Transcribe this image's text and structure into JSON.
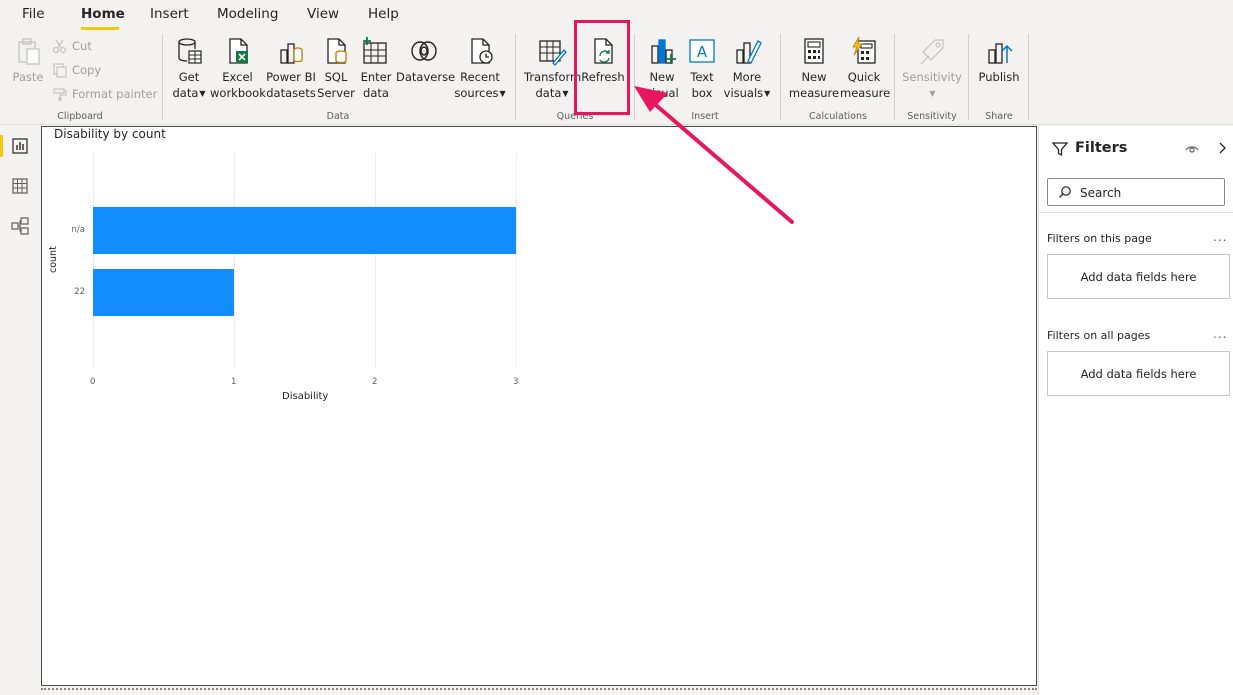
{
  "menu": {
    "tabs": [
      {
        "label": "File"
      },
      {
        "label": "Home"
      },
      {
        "label": "Insert"
      },
      {
        "label": "Modeling"
      },
      {
        "label": "View"
      },
      {
        "label": "Help"
      }
    ],
    "active_tab": "Home"
  },
  "ribbon": {
    "clipboard": {
      "paste": "Paste",
      "cut": "Cut",
      "copy": "Copy",
      "format_painter": "Format painter",
      "group_label": "Clipboard"
    },
    "data": {
      "get_data_l1": "Get",
      "get_data_l2": "data",
      "excel_l1": "Excel",
      "excel_l2": "workbook",
      "powerbi_l1": "Power BI",
      "powerbi_l2": "datasets",
      "sql_l1": "SQL",
      "sql_l2": "Server",
      "enter_l1": "Enter",
      "enter_l2": "data",
      "dataverse": "Dataverse",
      "recent_l1": "Recent",
      "recent_l2": "sources",
      "group_label": "Data"
    },
    "queries": {
      "transform_l1": "Transform",
      "transform_l2": "data",
      "refresh": "Refresh",
      "group_label": "Queries"
    },
    "insert": {
      "new_visual_l1": "New",
      "new_visual_l2": "visual",
      "text_box_l1": "Text",
      "text_box_l2": "box",
      "more_visuals_l1": "More",
      "more_visuals_l2": "visuals",
      "group_label": "Insert"
    },
    "calculations": {
      "new_measure_l1": "New",
      "new_measure_l2": "measure",
      "quick_measure_l1": "Quick",
      "quick_measure_l2": "measure",
      "group_label": "Calculations"
    },
    "sensitivity": {
      "label": "Sensitivity",
      "group_label": "Sensitivity"
    },
    "share": {
      "publish": "Publish",
      "group_label": "Share"
    }
  },
  "chart": {
    "title": "Disability by count",
    "y_axis_title": "count",
    "x_axis_title": "Disability"
  },
  "chart_data": {
    "type": "bar",
    "orientation": "horizontal",
    "title": "Disability by count",
    "categories": [
      "n/a",
      "22"
    ],
    "values": [
      3,
      1
    ],
    "xlabel": "Disability",
    "ylabel": "count",
    "xlim": [
      0,
      3
    ],
    "x_ticks": [
      "0",
      "1",
      "2",
      "3"
    ],
    "grid": true,
    "bar_color": "#118dff"
  },
  "filters": {
    "title": "Filters",
    "search_placeholder": "Search",
    "on_this_page": "Filters on this page",
    "on_all_pages": "Filters on all pages",
    "add_fields": "Add data fields here",
    "more": "..."
  },
  "colors": {
    "accent": "#f2c811",
    "bar": "#118dff",
    "annotation": "#e8155f"
  }
}
